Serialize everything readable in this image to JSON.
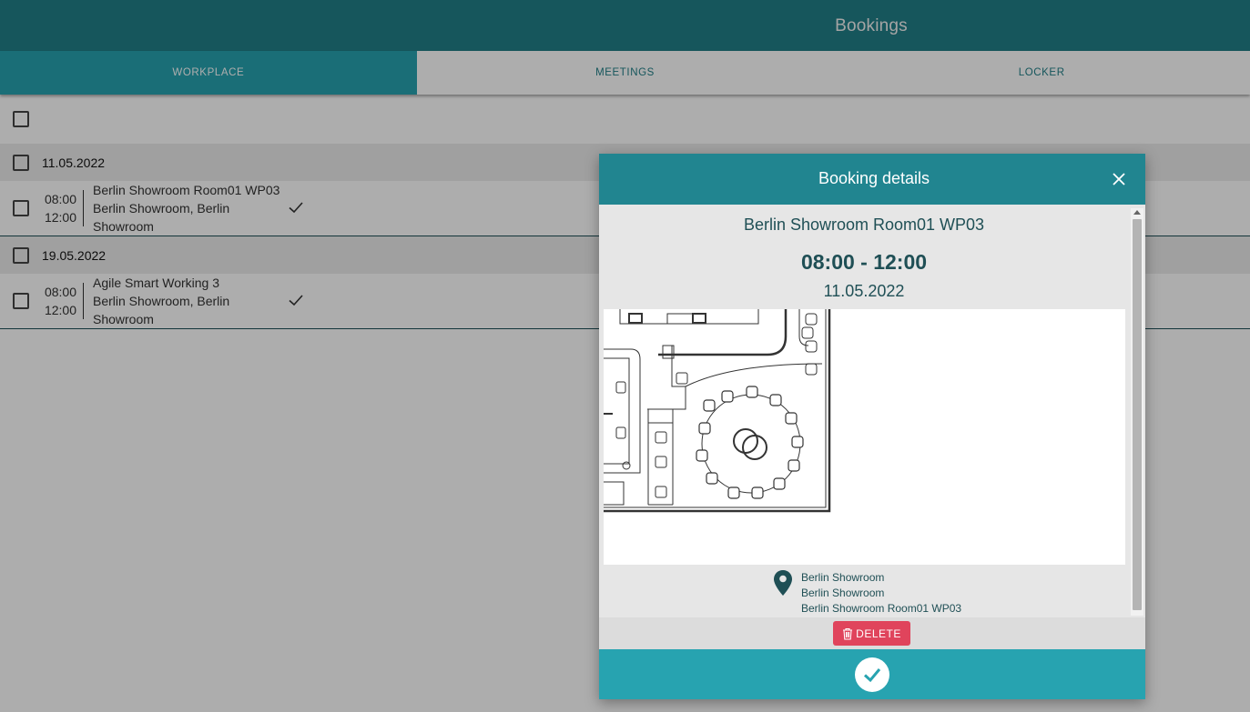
{
  "header": {
    "title": "Bookings"
  },
  "tabs": [
    {
      "label": "WORKPLACE",
      "active": true
    },
    {
      "label": "MEETINGS",
      "active": false
    },
    {
      "label": "LOCKER",
      "active": false
    }
  ],
  "groups": [
    {
      "date": "11.05.2022",
      "bookings": [
        {
          "start": "08:00",
          "end": "12:00",
          "line1": "Berlin Showroom Room01 WP03",
          "line2": "Berlin Showroom, Berlin Showroom",
          "status_icon": "check-icon"
        }
      ]
    },
    {
      "date": "19.05.2022",
      "bookings": [
        {
          "start": "08:00",
          "end": "12:00",
          "line1": "Agile Smart Working 3",
          "line2": "Berlin Showroom, Berlin Showroom",
          "status_icon": "check-icon"
        }
      ]
    }
  ],
  "modal": {
    "title": "Booking details",
    "workplace": "Berlin Showroom Room01 WP03",
    "time_range": "08:00 - 12:00",
    "date": "11.05.2022",
    "location": {
      "line1": "Berlin Showroom",
      "line2": "Berlin Showroom",
      "line3": "Berlin Showroom Room01 WP03"
    },
    "delete_label": "DELETE",
    "confirm_icon": "check-icon"
  },
  "colors": {
    "header": "#217f88",
    "tab_active": "#27a3b0",
    "modal_header": "#218590",
    "delete": "#e0445c"
  }
}
